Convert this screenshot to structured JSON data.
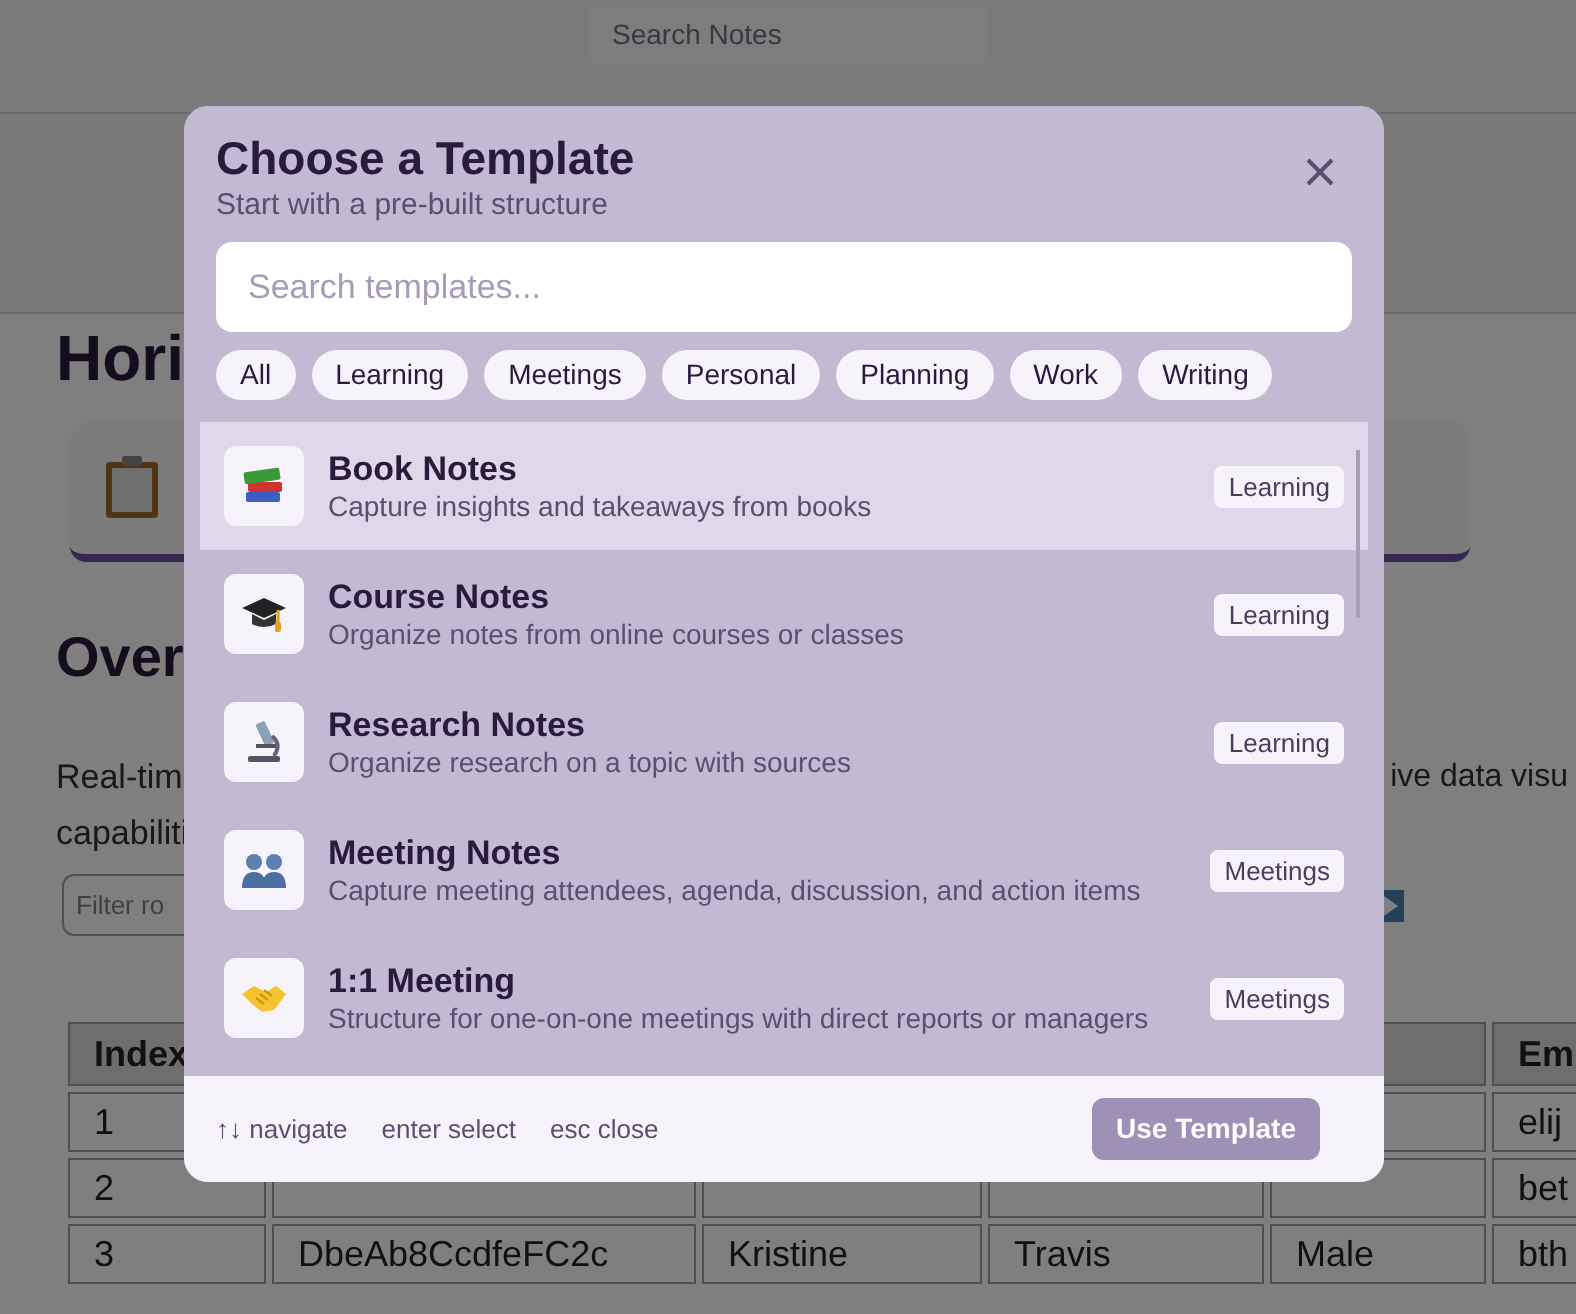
{
  "page": {
    "search": {
      "placeholder": "Search Notes"
    },
    "heading_1": "Hori",
    "heading_2": "Over",
    "paragraph_left": [
      "Real-tim",
      "capabiliti"
    ],
    "paragraph_right": "ive data visu",
    "filter": {
      "placeholder": "Filter ro"
    },
    "table": {
      "columns": [
        "Index",
        "",
        "",
        "",
        "",
        "Em"
      ],
      "rows": [
        [
          "1",
          "",
          "",
          "",
          "",
          "elij"
        ],
        [
          "2",
          "",
          "",
          "",
          "",
          "bet"
        ],
        [
          "3",
          "DbeAb8CcdfeFC2c",
          "Kristine",
          "Travis",
          "Male",
          "bth"
        ]
      ]
    }
  },
  "dialog": {
    "title": "Choose a Template",
    "subtitle": "Start with a pre-built structure",
    "search": {
      "placeholder": "Search templates..."
    },
    "filters": [
      "All",
      "Learning",
      "Meetings",
      "Personal",
      "Planning",
      "Work",
      "Writing"
    ],
    "templates": [
      {
        "kind": "books",
        "name": "Book Notes",
        "description": "Capture insights and takeaways from books",
        "tag": "Learning",
        "selected": true
      },
      {
        "kind": "cap",
        "name": "Course Notes",
        "description": "Organize notes from online courses or classes",
        "tag": "Learning",
        "selected": false
      },
      {
        "kind": "microscope",
        "name": "Research Notes",
        "description": "Organize research on a topic with sources",
        "tag": "Learning",
        "selected": false
      },
      {
        "kind": "people",
        "name": "Meeting Notes",
        "description": "Capture meeting attendees, agenda, discussion, and action items",
        "tag": "Meetings",
        "selected": false
      },
      {
        "kind": "handshake",
        "name": "1:1 Meeting",
        "description": "Structure for one-on-one meetings with direct reports or managers",
        "tag": "Meetings",
        "selected": false
      }
    ],
    "hints": [
      {
        "key": "↑↓",
        "label": "navigate"
      },
      {
        "key": "enter",
        "label": "select"
      },
      {
        "key": "esc",
        "label": "close"
      }
    ],
    "action": "Use Template"
  }
}
